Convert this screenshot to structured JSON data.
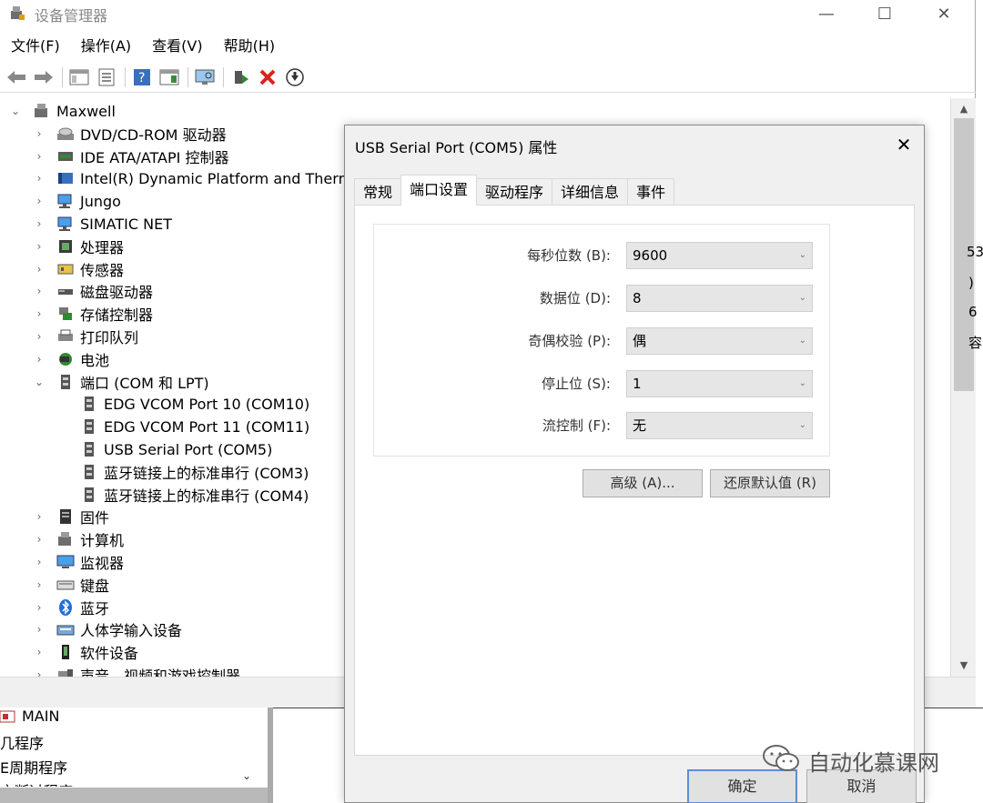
{
  "window": {
    "title": "设备管理器",
    "min_glyph": "—",
    "max_glyph": "☐",
    "close_glyph": "✕"
  },
  "menu": [
    "文件(F)",
    "操作(A)",
    "查看(V)",
    "帮助(H)"
  ],
  "tree": {
    "root": "Maxwell",
    "items": [
      {
        "label": "DVD/CD-ROM 驱动器",
        "icon": "dvd-drive-icon",
        "expander": "›"
      },
      {
        "label": "IDE ATA/ATAPI 控制器",
        "icon": "ide-controller-icon",
        "expander": "›"
      },
      {
        "label": "Intel(R) Dynamic Platform and Thermal",
        "icon": "intel-platform-icon",
        "expander": "›"
      },
      {
        "label": "Jungo",
        "icon": "network-device-icon",
        "expander": "›"
      },
      {
        "label": "SIMATIC NET",
        "icon": "network-device-icon",
        "expander": "›"
      },
      {
        "label": "处理器",
        "icon": "processor-icon",
        "expander": "›"
      },
      {
        "label": "传感器",
        "icon": "sensor-icon",
        "expander": "›"
      },
      {
        "label": "磁盘驱动器",
        "icon": "disk-drive-icon",
        "expander": "›"
      },
      {
        "label": "存储控制器",
        "icon": "storage-controller-icon",
        "expander": "›"
      },
      {
        "label": "打印队列",
        "icon": "printer-icon",
        "expander": "›"
      },
      {
        "label": "电池",
        "icon": "battery-icon",
        "expander": "›"
      },
      {
        "label": "端口 (COM 和 LPT)",
        "icon": "port-icon",
        "expander": "⌄"
      }
    ],
    "ports": [
      "EDG VCOM Port 10 (COM10)",
      "EDG VCOM Port 11 (COM11)",
      "USB Serial Port (COM5)",
      "蓝牙链接上的标准串行 (COM3)",
      "蓝牙链接上的标准串行 (COM4)"
    ],
    "items_after": [
      {
        "label": "固件",
        "icon": "firmware-icon"
      },
      {
        "label": "计算机",
        "icon": "computer-icon"
      },
      {
        "label": "监视器",
        "icon": "monitor-icon"
      },
      {
        "label": "键盘",
        "icon": "keyboard-icon"
      },
      {
        "label": "蓝牙",
        "icon": "bluetooth-icon"
      },
      {
        "label": "人体学输入设备",
        "icon": "hid-icon"
      },
      {
        "label": "软件设备",
        "icon": "software-device-icon"
      },
      {
        "label": "声音、视频和游戏控制器",
        "icon": "sound-icon"
      }
    ]
  },
  "background": {
    "right_fragments": [
      "53",
      ")",
      "6",
      "容"
    ],
    "program_rows": [
      "MAIN",
      "几程序",
      "E周期程序",
      "亡断过程序"
    ]
  },
  "dialog": {
    "title": "USB Serial Port (COM5) 属性",
    "tabs": [
      "常规",
      "端口设置",
      "驱动程序",
      "详细信息",
      "事件"
    ],
    "active_tab": "端口设置",
    "fields": [
      {
        "label": "每秒位数 (B):",
        "value": "9600"
      },
      {
        "label": "数据位 (D):",
        "value": "8"
      },
      {
        "label": "奇偶校验 (P):",
        "value": "偶"
      },
      {
        "label": "停止位 (S):",
        "value": "1"
      },
      {
        "label": "流控制 (F):",
        "value": "无"
      }
    ],
    "advanced_button": "高级 (A)...",
    "restore_button": "还原默认值 (R)",
    "ok_button": "确定",
    "cancel_button": "取消"
  },
  "watermark": "自动化慕课网",
  "colors": {
    "accent_blue": "#5b8fd4",
    "delete_red": "#d9231c",
    "toolbar_green": "#2e8b2e"
  }
}
